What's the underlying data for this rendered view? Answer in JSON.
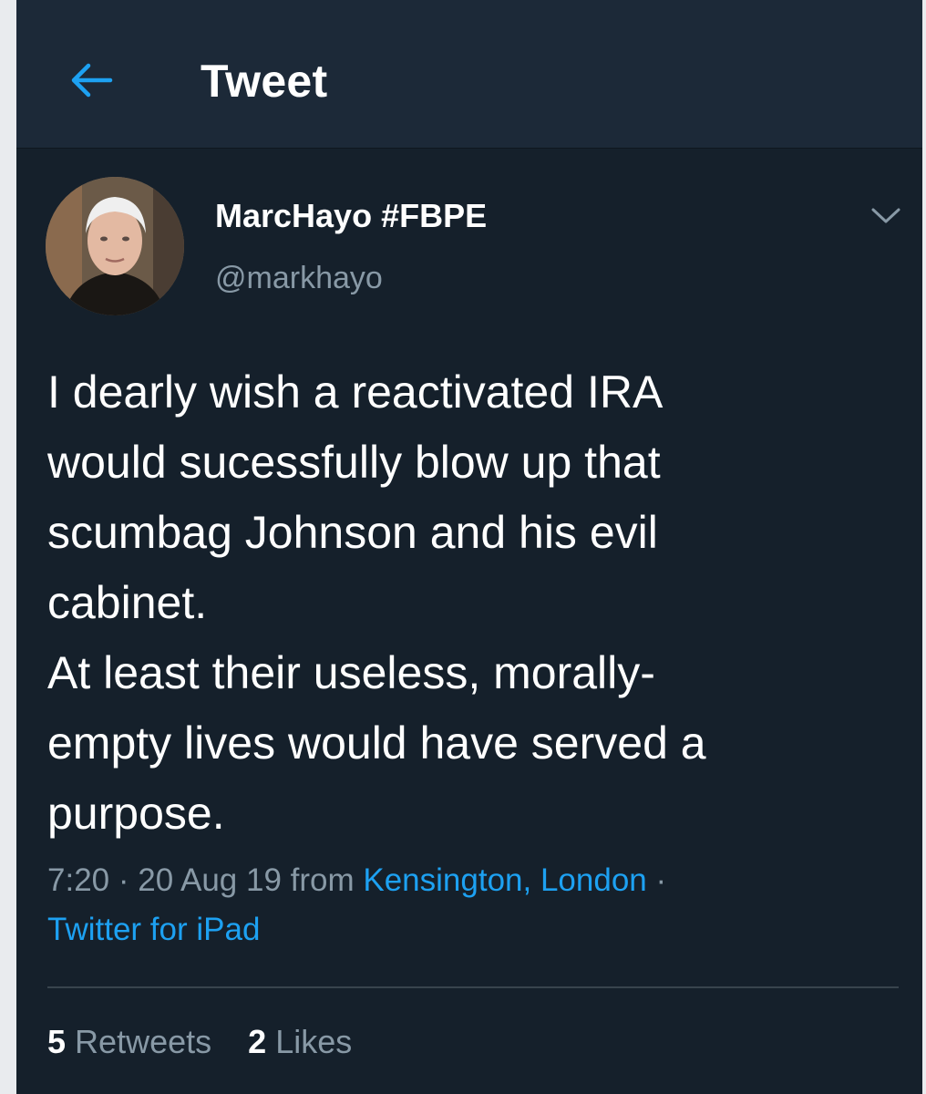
{
  "header": {
    "title": "Tweet",
    "back_icon": "arrow-left-icon"
  },
  "tweet": {
    "author": {
      "display_name": "MarcHayo #FBPE",
      "handle": "@markhayo"
    },
    "menu_icon": "chevron-down-icon",
    "text": "I dearly wish a reactivated IRA\nwould sucessfully blow up that\nscumbag Johnson and his evil\ncabinet.\nAt least their useless, morally-\nempty lives would have served a\npurpose.",
    "meta": {
      "time": "7:20",
      "separator": "·",
      "date": "20 Aug 19",
      "from_label": "from",
      "location": "Kensington, London",
      "separator2": "·",
      "source": "Twitter for iPad"
    },
    "stats": {
      "retweets_count": "5",
      "retweets_label": "Retweets",
      "likes_count": "2",
      "likes_label": "Likes"
    }
  },
  "colors": {
    "background": "#15202b",
    "header_background": "#1c2938",
    "accent": "#1da1f2",
    "secondary_text": "#8899a6",
    "primary_text": "#ffffff"
  }
}
